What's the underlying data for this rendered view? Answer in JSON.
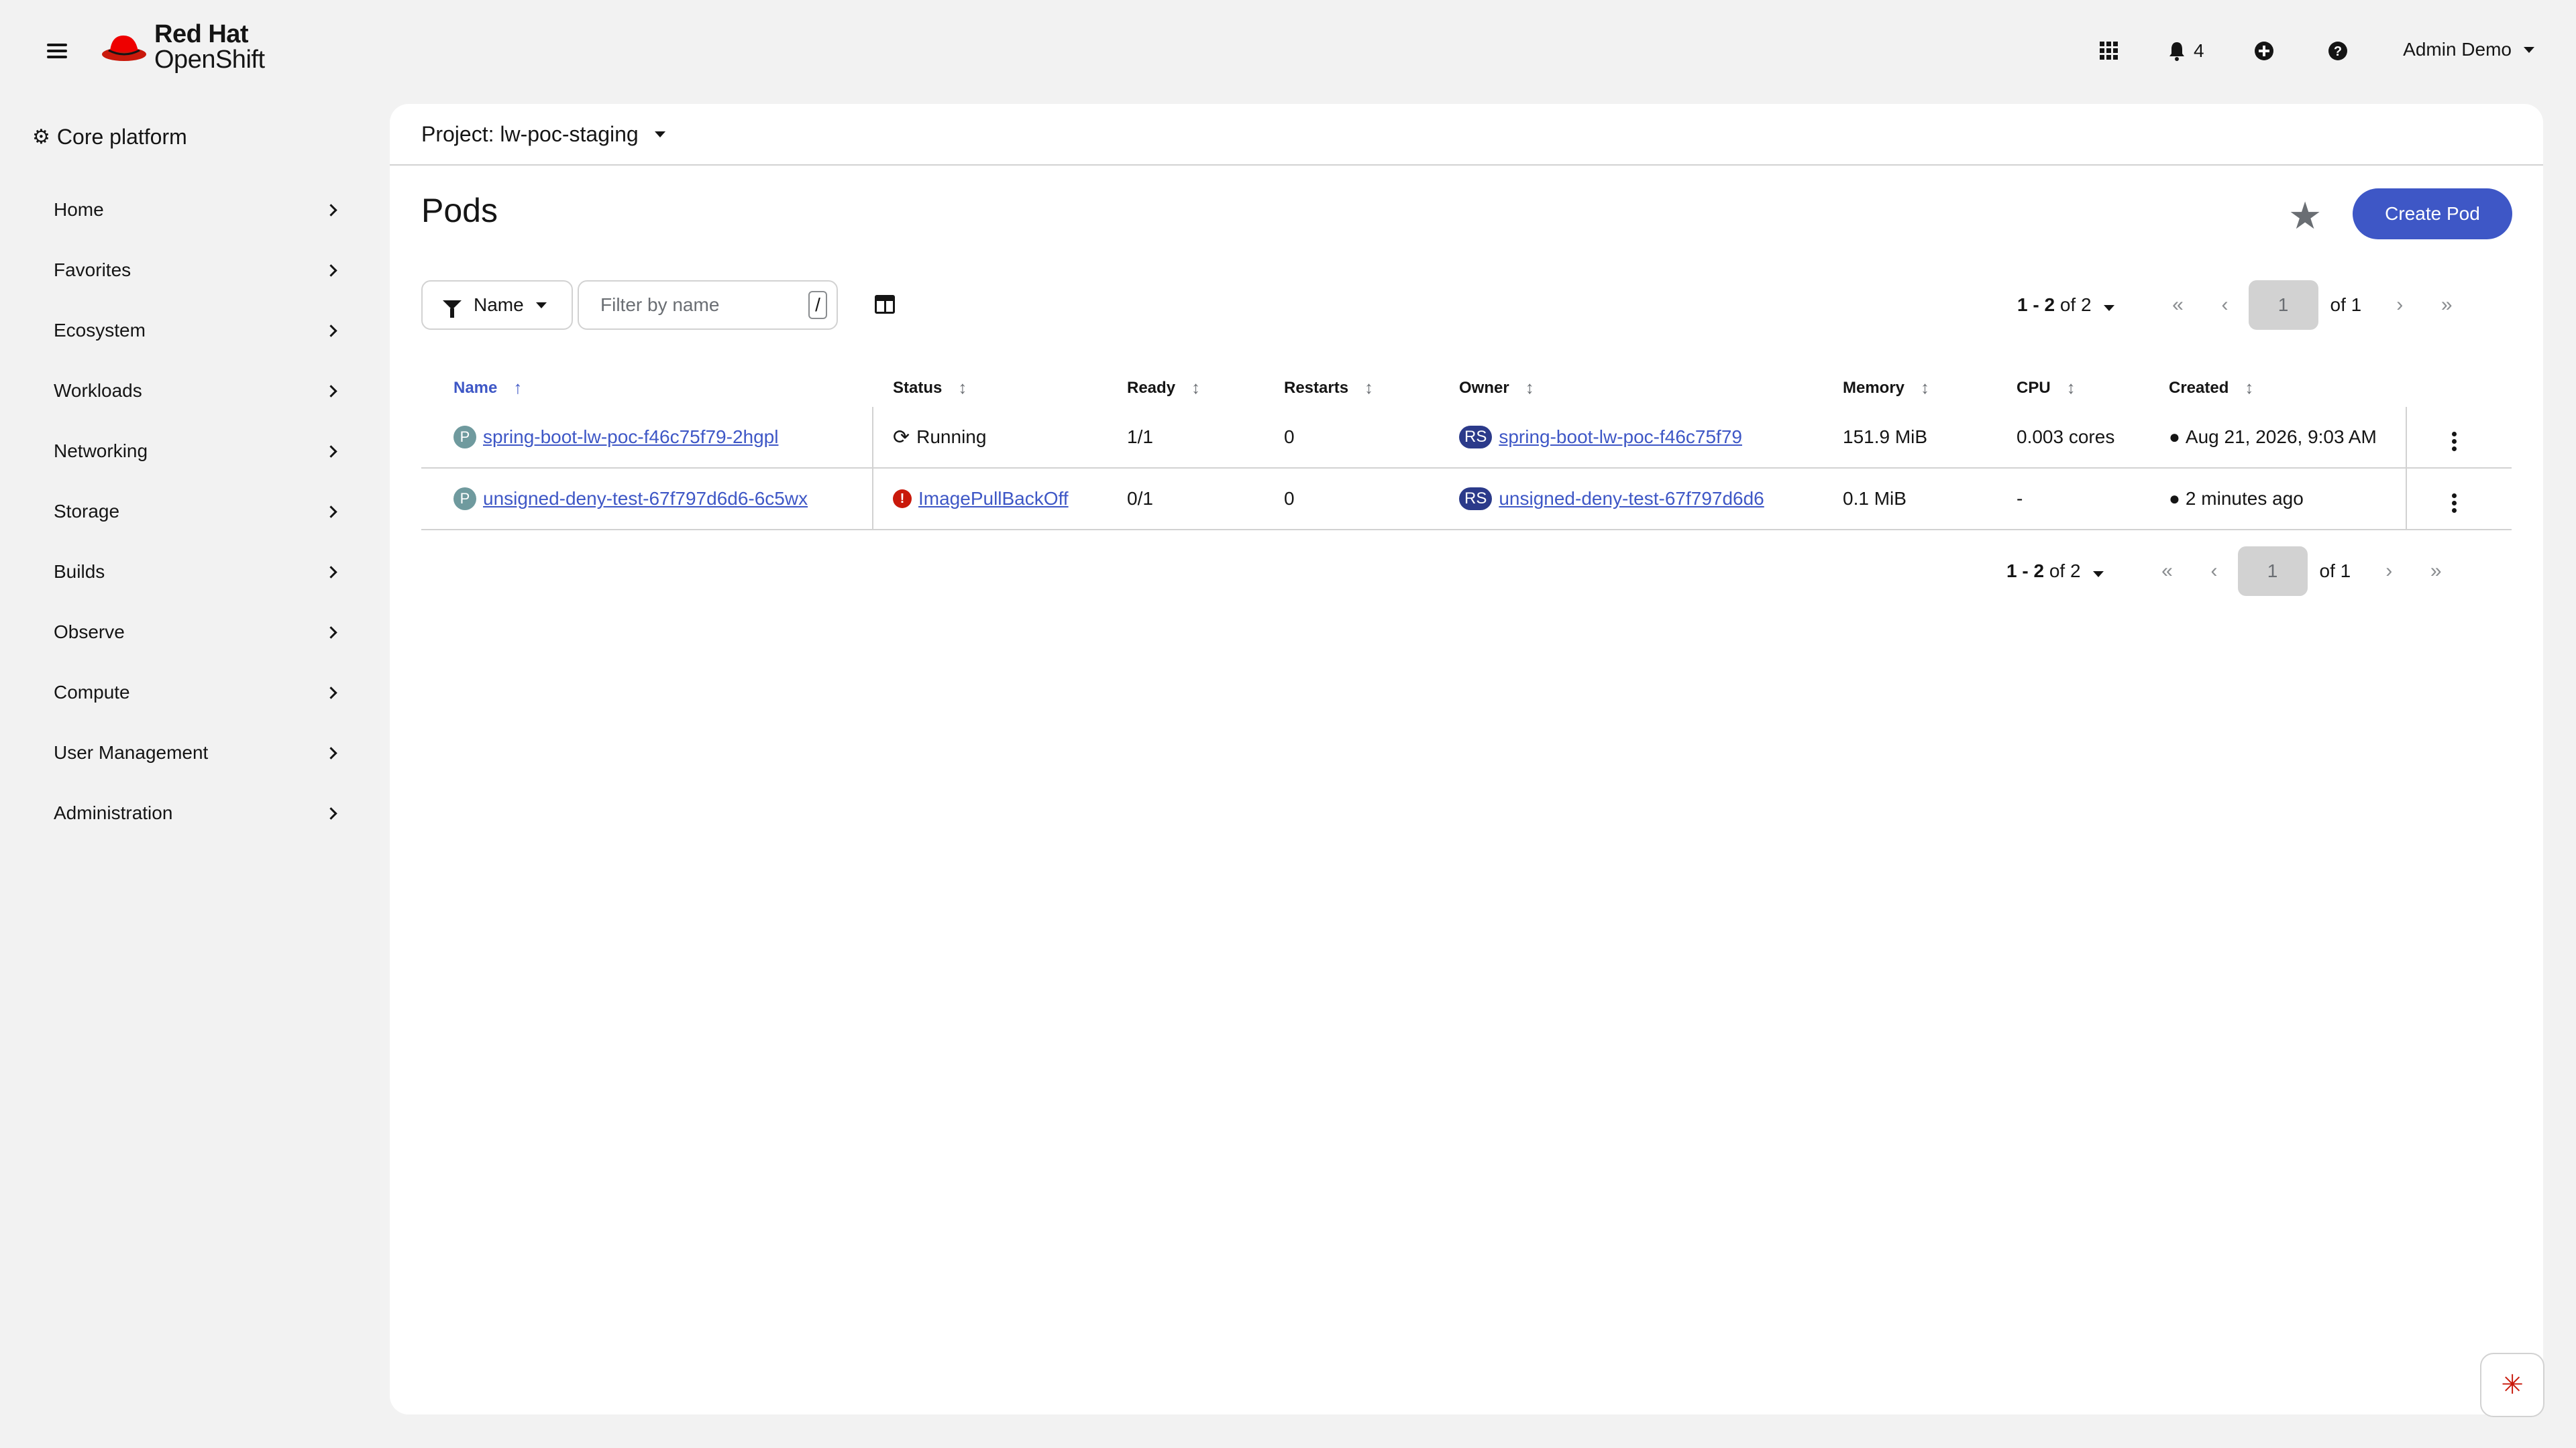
{
  "masthead": {
    "brand_line1": "Red Hat",
    "brand_line2": "OpenShift",
    "notifications_count": "4",
    "user": "Admin Demo"
  },
  "sidebar": {
    "perspective": "Core platform",
    "items": [
      {
        "label": "Home"
      },
      {
        "label": "Favorites"
      },
      {
        "label": "Ecosystem"
      },
      {
        "label": "Workloads"
      },
      {
        "label": "Networking"
      },
      {
        "label": "Storage"
      },
      {
        "label": "Builds"
      },
      {
        "label": "Observe"
      },
      {
        "label": "Compute"
      },
      {
        "label": "User Management"
      },
      {
        "label": "Administration"
      }
    ]
  },
  "main": {
    "project": "Project: lw-poc-staging",
    "title": "Pods",
    "create_label": "Create Pod",
    "filter_label": "Name",
    "search_placeholder": "Filter by name",
    "search_shortcut": "/",
    "pagination": {
      "range": "1 - 2",
      "of_total": "of 2",
      "page": "1",
      "of_pages": "of 1"
    }
  },
  "table": {
    "columns": [
      "Name",
      "Status",
      "Ready",
      "Restarts",
      "Owner",
      "Memory",
      "CPU",
      "Created"
    ],
    "rows": [
      {
        "badge": "P",
        "name": "spring-boot-lw-poc-f46c75f79-2hgpl",
        "status": "Running",
        "ready": "1/1",
        "restarts": "0",
        "owner_badge": "RS",
        "owner": "spring-boot-lw-poc-f46c75f79",
        "memory": "151.9 MiB",
        "cpu": "0.003 cores",
        "created": "Aug 21, 2026, 9:03 AM"
      },
      {
        "badge": "P",
        "name": "unsigned-deny-test-67f797d6d6-6c5wx",
        "status": "ImagePullBackOff",
        "ready": "0/1",
        "restarts": "0",
        "owner_badge": "RS",
        "owner": "unsigned-deny-test-67f797d6d6",
        "memory": "0.1 MiB",
        "cpu": "-",
        "created": "2 minutes ago"
      }
    ]
  }
}
